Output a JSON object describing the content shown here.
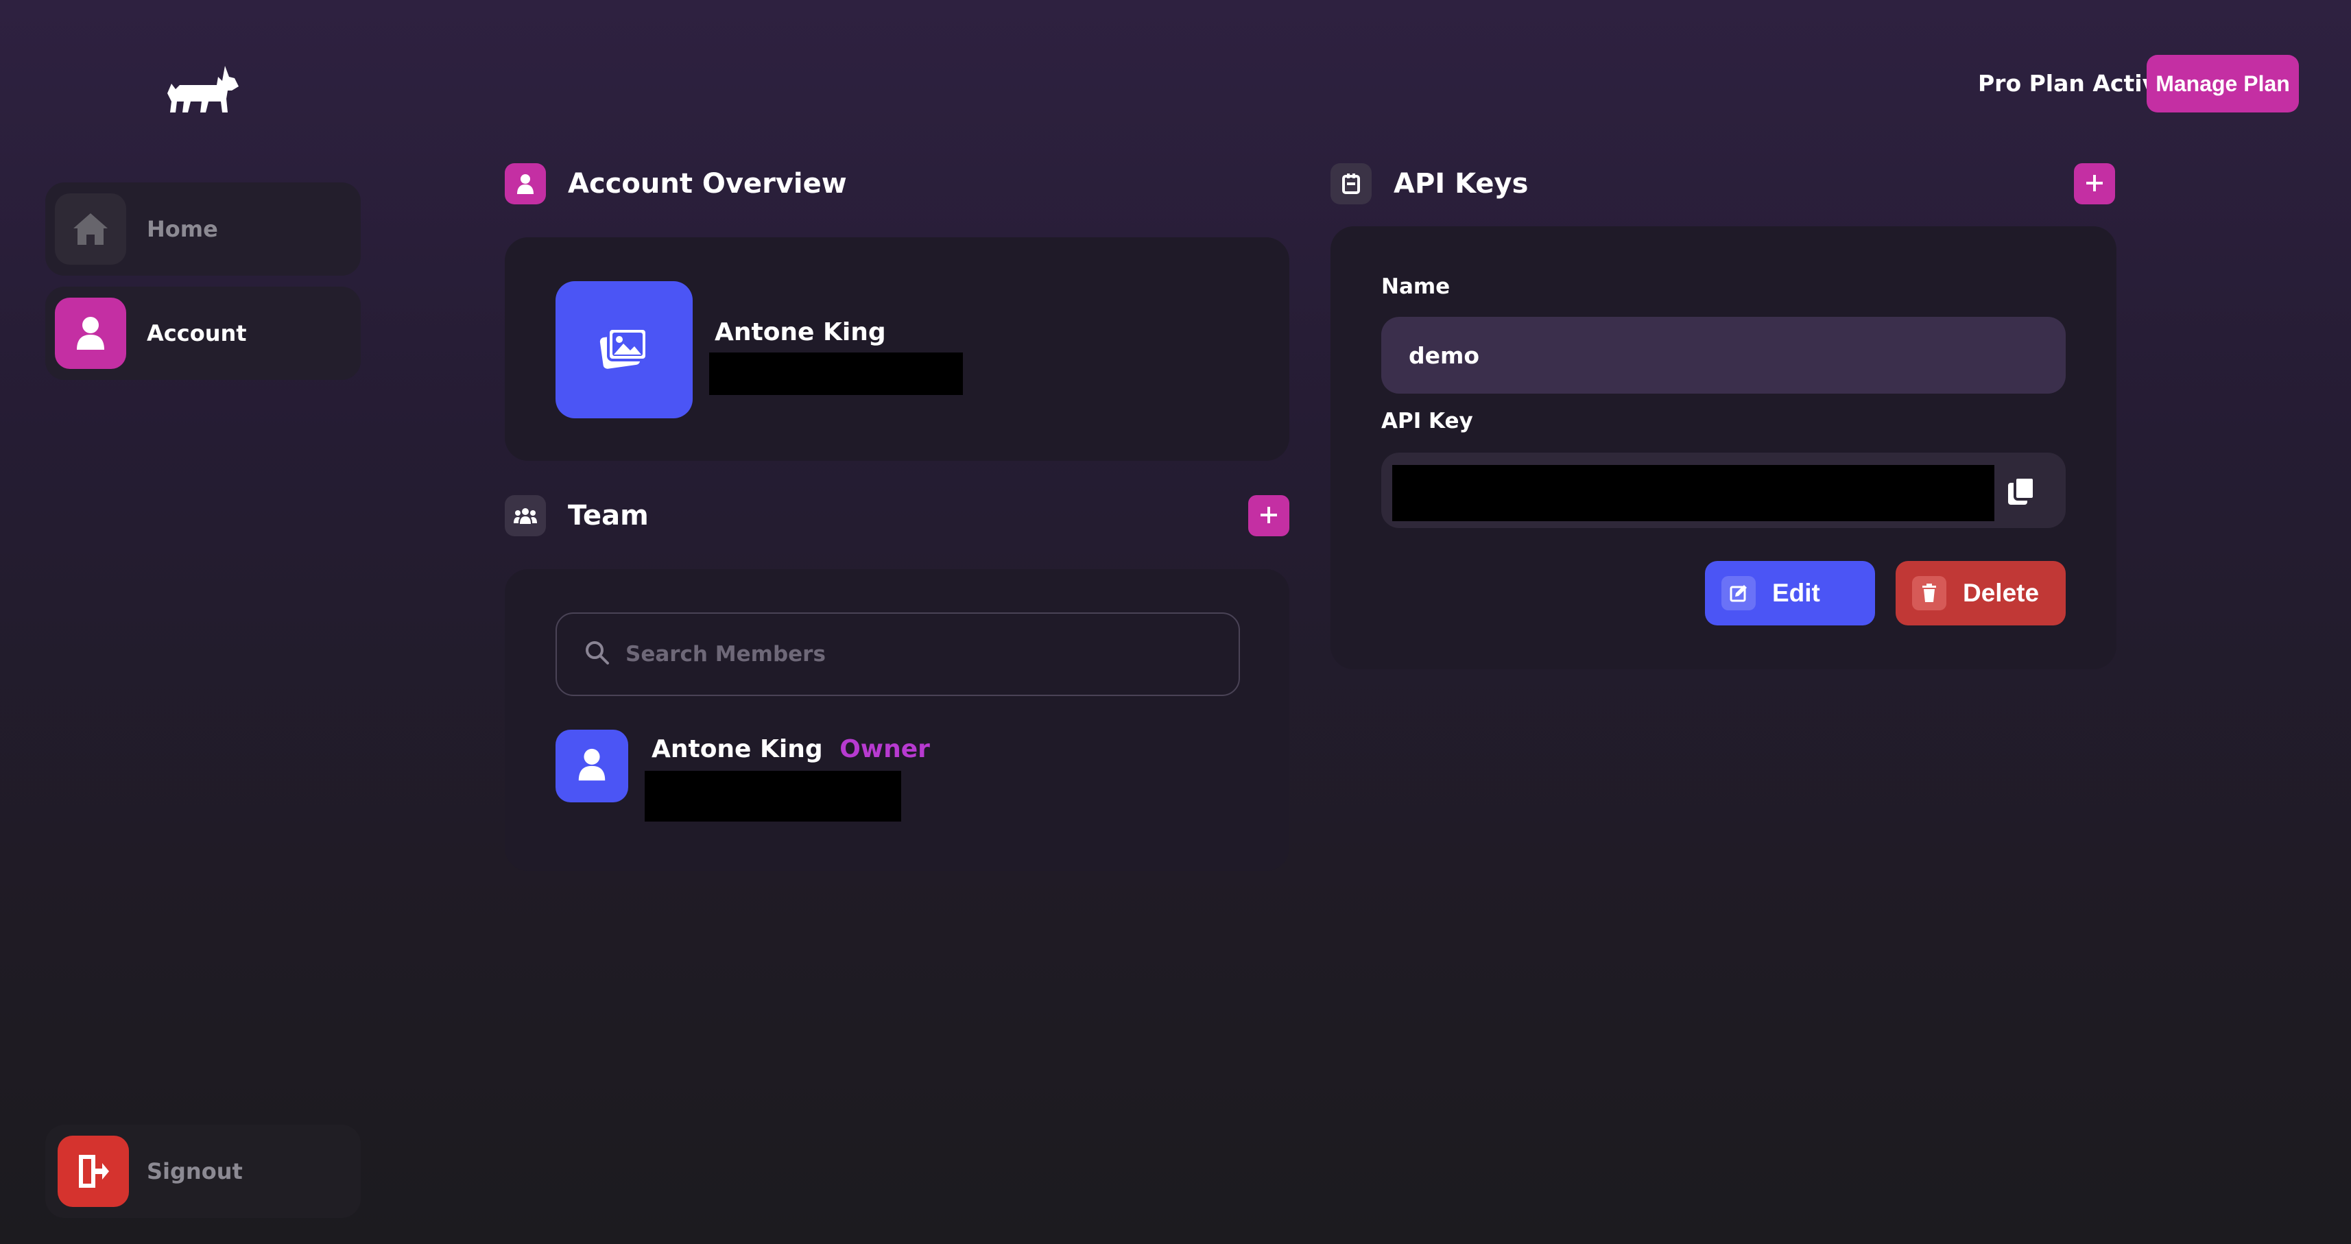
{
  "header": {
    "plan_status": "Pro Plan Active",
    "manage_plan_label": "Manage Plan"
  },
  "sidebar": {
    "items": [
      {
        "label": "Home",
        "icon": "home-icon"
      },
      {
        "label": "Account",
        "icon": "user-icon"
      }
    ],
    "signout_label": "Signout"
  },
  "account_overview": {
    "title": "Account Overview",
    "name": "Antone King"
  },
  "team": {
    "title": "Team",
    "search_placeholder": "Search Members",
    "members": [
      {
        "name": "Antone King",
        "role": "Owner"
      }
    ]
  },
  "api_keys": {
    "title": "API Keys",
    "name_label": "Name",
    "name_value": "demo",
    "key_label": "API Key",
    "edit_label": "Edit",
    "delete_label": "Delete"
  },
  "colors": {
    "accent_pink": "#c42fa3",
    "accent_blue": "#4b55f5",
    "danger_red": "#c13836",
    "owner_role": "#b73ad0"
  }
}
